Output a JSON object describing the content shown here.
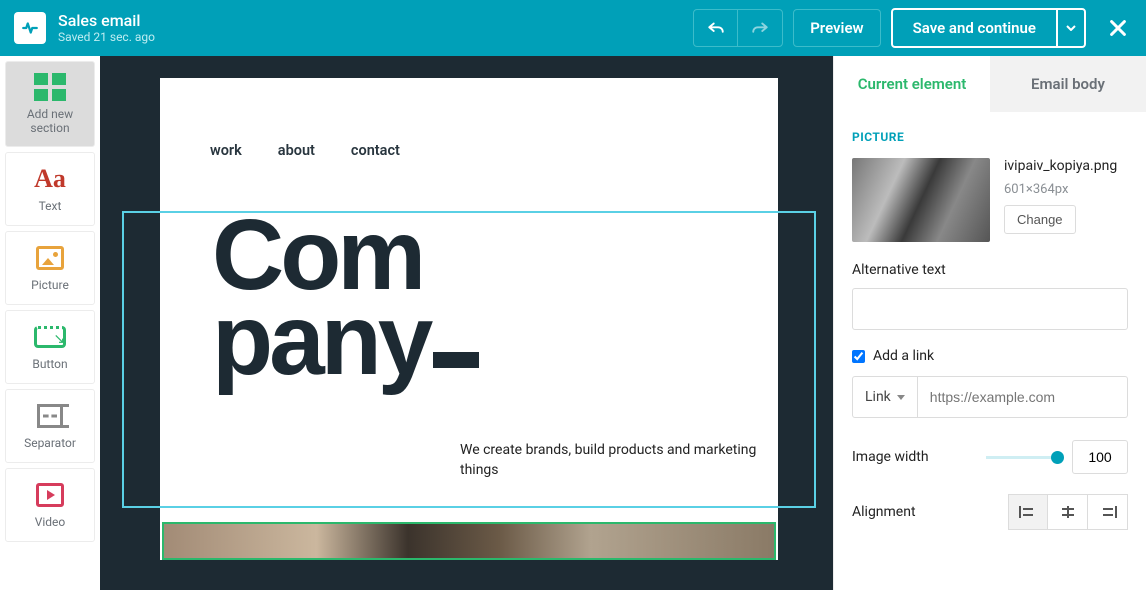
{
  "header": {
    "title": "Sales email",
    "status": "Saved 21 sec. ago",
    "preview": "Preview",
    "save": "Save and continue"
  },
  "sidebar": {
    "addSection": "Add new section",
    "text": "Text",
    "picture": "Picture",
    "button": "Button",
    "separator": "Separator",
    "video": "Video"
  },
  "canvas": {
    "nav": [
      "work",
      "about",
      "contact"
    ],
    "heroLine1": "Com",
    "heroLine2": "pany",
    "tagline": "We create brands, build products and marketing things"
  },
  "panel": {
    "tabs": {
      "current": "Current element",
      "body": "Email body"
    },
    "sectionTitle": "PICTURE",
    "fileName": "ivipaiv_kopiya.png",
    "dimensions": "601×364px",
    "change": "Change",
    "altLabel": "Alternative text",
    "altValue": "",
    "addLinkLabel": "Add a link",
    "addLinkChecked": true,
    "linkType": "Link",
    "linkPlaceholder": "https://example.com",
    "widthLabel": "Image width",
    "widthValue": "100",
    "alignLabel": "Alignment"
  }
}
